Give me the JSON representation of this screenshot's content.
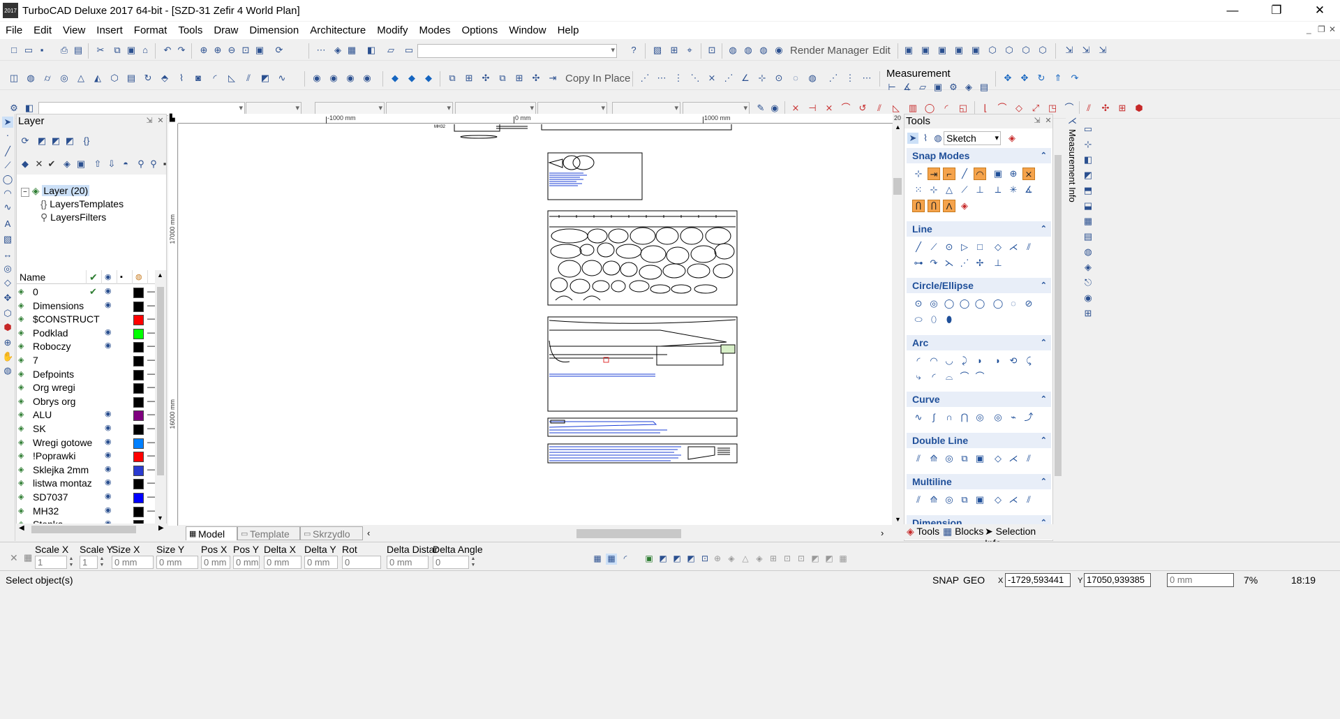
{
  "window": {
    "title": "TurboCAD Deluxe 2017 64-bit - [SZD-31 Zefir 4 World Plan]",
    "logo": "2017",
    "minimize": "—",
    "maximize": "❐",
    "close": "✕"
  },
  "menu": [
    "File",
    "Edit",
    "View",
    "Insert",
    "Format",
    "Tools",
    "Draw",
    "Dimension",
    "Architecture",
    "Modify",
    "Modes",
    "Options",
    "Window",
    "Help"
  ],
  "menu_mdi": {
    "minimize": "_",
    "restore": "❐",
    "close": "✕"
  },
  "toolbar1": {
    "render_manager": "Render Manager",
    "edit": "Edit"
  },
  "toolbar2": {
    "copy_in_place": "Copy In Place",
    "measurement": "Measurement"
  },
  "layer_panel": {
    "title": "Layer",
    "tree": {
      "root": "Layer (20)",
      "children": [
        "LayersTemplates",
        "LayersFilters"
      ]
    },
    "columns": [
      "Name"
    ],
    "rows": [
      {
        "name": "0",
        "checked": true,
        "visible": true,
        "color": "#000000"
      },
      {
        "name": "Dimensions",
        "checked": false,
        "visible": true,
        "color": "#000000"
      },
      {
        "name": "$CONSTRUCT",
        "checked": false,
        "visible": false,
        "color": "#ff0000"
      },
      {
        "name": "Podklad",
        "checked": false,
        "visible": true,
        "color": "#00ff00"
      },
      {
        "name": "Roboczy",
        "checked": false,
        "visible": true,
        "color": "#000000"
      },
      {
        "name": "7",
        "checked": false,
        "visible": false,
        "color": "#000000"
      },
      {
        "name": "Defpoints",
        "checked": false,
        "visible": false,
        "color": "#000000"
      },
      {
        "name": "Org wregi",
        "checked": false,
        "visible": false,
        "color": "#000000"
      },
      {
        "name": "Obrys org",
        "checked": false,
        "visible": false,
        "color": "#000000"
      },
      {
        "name": "ALU",
        "checked": false,
        "visible": true,
        "color": "#7f007f"
      },
      {
        "name": "SK",
        "checked": false,
        "visible": true,
        "color": "#000000"
      },
      {
        "name": "Wregi gotowe",
        "checked": false,
        "visible": true,
        "color": "#0080ff"
      },
      {
        "name": "!Poprawki",
        "checked": false,
        "visible": true,
        "color": "#ff0000"
      },
      {
        "name": "Sklejka 2mm",
        "checked": false,
        "visible": true,
        "color": "#2a3bd0"
      },
      {
        "name": "listwa montaz",
        "checked": false,
        "visible": true,
        "color": "#000000"
      },
      {
        "name": "SD7037",
        "checked": false,
        "visible": true,
        "color": "#0000ff"
      },
      {
        "name": "MH32",
        "checked": false,
        "visible": true,
        "color": "#000000"
      },
      {
        "name": "Stenka",
        "checked": false,
        "visible": true,
        "color": "#000000"
      }
    ]
  },
  "rulers": {
    "h_labels": [
      "-1000 mm",
      "0 mm",
      "1000 mm"
    ],
    "h_end": "20",
    "v_labels": [
      "17000 mm",
      "16000 mm"
    ],
    "sheet_label": "MH32"
  },
  "canvas_tabs": [
    "Model",
    "Template",
    "Skrzydlo"
  ],
  "tools_panel": {
    "title": "Tools",
    "mode": "Sketch",
    "sections": [
      {
        "name": "Snap Modes"
      },
      {
        "name": "Line"
      },
      {
        "name": "Circle/Ellipse"
      },
      {
        "name": "Arc"
      },
      {
        "name": "Curve"
      },
      {
        "name": "Double Line"
      },
      {
        "name": "Multiline"
      },
      {
        "name": "Dimension"
      }
    ],
    "tabs": [
      "Tools",
      "Blocks",
      "Selection Info"
    ]
  },
  "measure_info": "Measurement Info",
  "inspector": {
    "labels": [
      "Scale X",
      "Scale Y",
      "Size X",
      "Size Y",
      "Pos X",
      "Pos Y",
      "Delta X",
      "Delta Y",
      "Rot",
      "Delta Distar",
      "Delta Angle"
    ],
    "values": [
      "1",
      "1",
      "0 mm",
      "0 mm",
      "0 mm",
      "0 mm",
      "0 mm",
      "0 mm",
      "0",
      "0 mm",
      "0"
    ]
  },
  "status": {
    "message": "Select object(s)",
    "snap": "SNAP",
    "geo": "GEO",
    "x_label": "X",
    "x": "-1729,593441",
    "y_label": "Y",
    "y": "17050,939385",
    "z": "0 mm",
    "zoom": "7%",
    "time": "18:19"
  }
}
